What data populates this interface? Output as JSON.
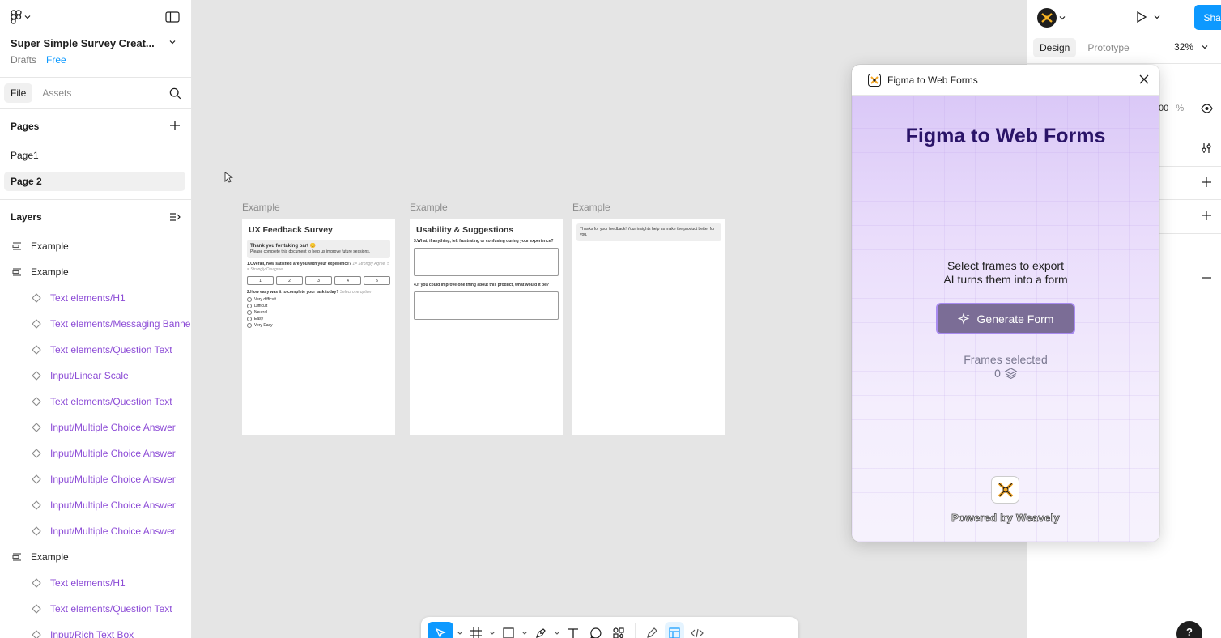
{
  "header": {
    "file_title": "Super Simple Survey Creat...",
    "location": "Drafts",
    "plan": "Free"
  },
  "left_tabs": {
    "file": "File",
    "assets": "Assets"
  },
  "pages": {
    "title": "Pages",
    "items": [
      {
        "label": "Page1",
        "active": false
      },
      {
        "label": "Page 2",
        "active": true
      }
    ]
  },
  "layers": {
    "title": "Layers",
    "items": [
      {
        "label": "Example",
        "kind": "frame"
      },
      {
        "label": "Example",
        "kind": "frame"
      },
      {
        "label": "Text elements/H1",
        "kind": "instance"
      },
      {
        "label": "Text elements/Messaging Banner",
        "kind": "instance"
      },
      {
        "label": "Text elements/Question Text",
        "kind": "instance"
      },
      {
        "label": "Input/Linear Scale",
        "kind": "instance"
      },
      {
        "label": "Text elements/Question Text",
        "kind": "instance"
      },
      {
        "label": "Input/Multiple Choice Answer",
        "kind": "instance"
      },
      {
        "label": "Input/Multiple Choice Answer",
        "kind": "instance"
      },
      {
        "label": "Input/Multiple Choice Answer",
        "kind": "instance"
      },
      {
        "label": "Input/Multiple Choice Answer",
        "kind": "instance"
      },
      {
        "label": "Input/Multiple Choice Answer",
        "kind": "instance"
      },
      {
        "label": "Example",
        "kind": "frame"
      },
      {
        "label": "Text elements/H1",
        "kind": "instance"
      },
      {
        "label": "Text elements/Question Text",
        "kind": "instance"
      },
      {
        "label": "Input/Rich Text Box",
        "kind": "instance"
      }
    ]
  },
  "canvas": {
    "frames": [
      {
        "label": "Example",
        "title": "UX Feedback Survey",
        "banner_title": "Thank you for taking part 😊",
        "banner_body": "Please complete this document to help us improve future sessions.",
        "q1": "1.Overall, how satisfied are you with your experience?",
        "q1_hint": "1= Strongly Agree, 5 = Strongly Disagree",
        "scale": [
          "1",
          "2",
          "3",
          "4",
          "5"
        ],
        "q2": "2.How easy was it to complete your task today?",
        "q2_hint": "Select one option",
        "options": [
          "Very difficult",
          "Difficult",
          "Neutral",
          "Easy",
          "Very Easy"
        ]
      },
      {
        "label": "Example",
        "title": "Usability & Suggestions",
        "q1": "3.What, if anything, felt frustrating or confusing during your experience?",
        "q2": "4.If you could improve one thing about this product, what would it be?"
      },
      {
        "label": "Example",
        "banner": "Thanks for your feedback! Your insights help us make the product better for you."
      }
    ]
  },
  "right_panel": {
    "share": "Share",
    "tab_design": "Design",
    "tab_prototype": "Prototype",
    "zoom": "32%",
    "opacity": "00",
    "opacity_unit": "%"
  },
  "plugin": {
    "window_title": "Figma to Web Forms",
    "heading": "Figma to Web Forms",
    "sub_line1": "Select frames to export",
    "sub_line2": "AI turns them into a form",
    "generate": "Generate Form",
    "frames_label": "Frames selected",
    "frames_count": "0",
    "powered_by": "Powered by Weavely"
  },
  "help": "?",
  "colors": {
    "accent": "#0d99ff",
    "instance_text": "#8c4bd6",
    "plugin_heading": "#2a1468",
    "generate_bg": "#7b6d96"
  }
}
